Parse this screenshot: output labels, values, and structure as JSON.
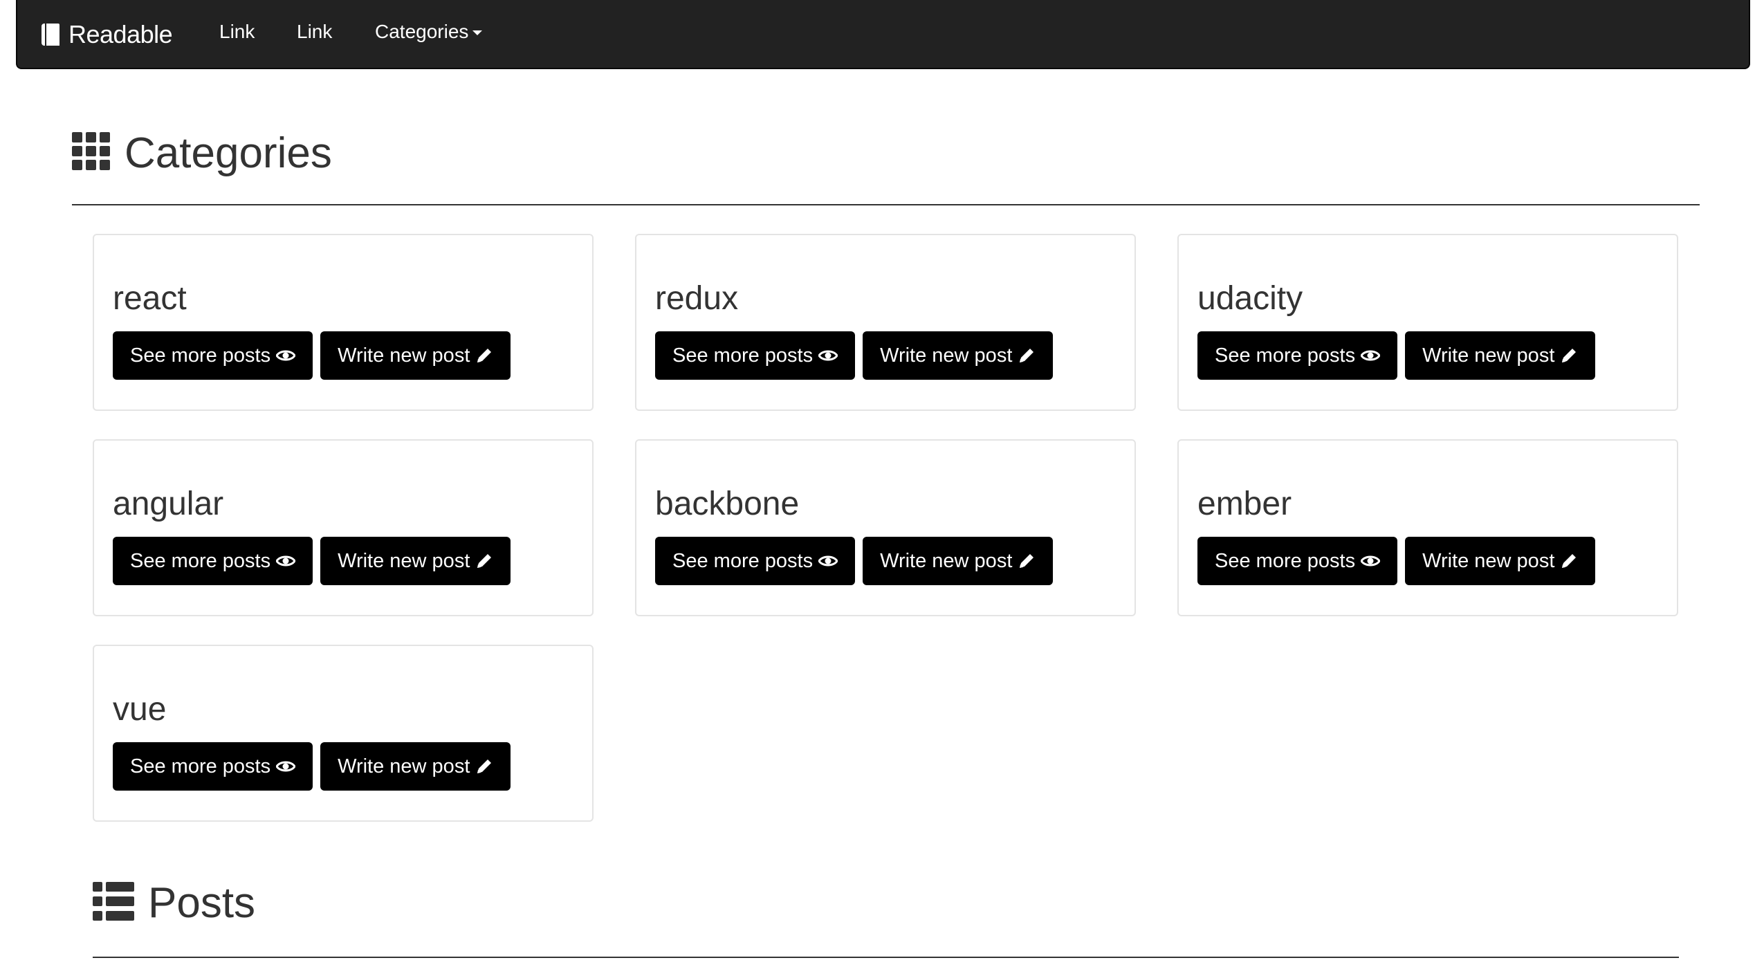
{
  "navbar": {
    "brand": "Readable",
    "links": [
      "Link",
      "Link"
    ],
    "dropdown_label": "Categories"
  },
  "categories_section": {
    "title": "Categories",
    "icon": "grid-icon",
    "cards": [
      {
        "name": "react",
        "see_more_label": "See more posts",
        "write_label": "Write new post"
      },
      {
        "name": "redux",
        "see_more_label": "See more posts",
        "write_label": "Write new post"
      },
      {
        "name": "udacity",
        "see_more_label": "See more posts",
        "write_label": "Write new post"
      },
      {
        "name": "angular",
        "see_more_label": "See more posts",
        "write_label": "Write new post"
      },
      {
        "name": "backbone",
        "see_more_label": "See more posts",
        "write_label": "Write new post"
      },
      {
        "name": "ember",
        "see_more_label": "See more posts",
        "write_label": "Write new post"
      },
      {
        "name": "vue",
        "see_more_label": "See more posts",
        "write_label": "Write new post"
      }
    ]
  },
  "posts_section": {
    "title": "Posts",
    "icon": "list-icon"
  },
  "colors": {
    "navbar_bg": "#222222",
    "button_bg": "#000000",
    "text": "#333333",
    "card_border": "#e4e4e4"
  }
}
